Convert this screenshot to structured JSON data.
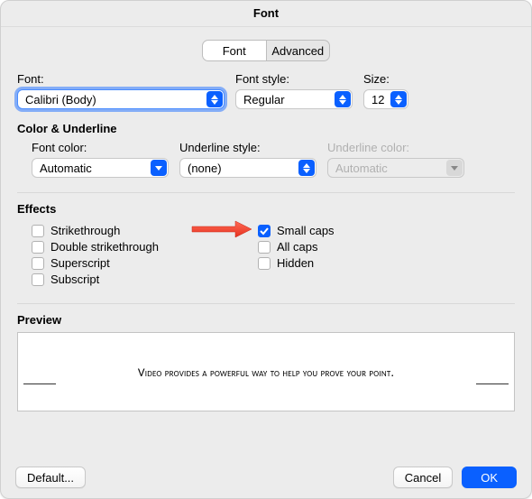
{
  "title": "Font",
  "tabs": {
    "font": "Font",
    "advanced": "Advanced"
  },
  "labels": {
    "font": "Font:",
    "font_style": "Font style:",
    "size": "Size:",
    "font_color": "Font color:",
    "underline_style": "Underline style:",
    "underline_color": "Underline color:"
  },
  "values": {
    "font": "Calibri (Body)",
    "font_style": "Regular",
    "size": "12",
    "font_color": "Automatic",
    "underline_style": "(none)",
    "underline_color": "Automatic"
  },
  "sections": {
    "color_underline": "Color & Underline",
    "effects": "Effects",
    "preview": "Preview"
  },
  "effects": {
    "strikethrough": {
      "label": "Strikethrough",
      "checked": false
    },
    "double_strikethrough": {
      "label": "Double strikethrough",
      "checked": false
    },
    "superscript": {
      "label": "Superscript",
      "checked": false
    },
    "subscript": {
      "label": "Subscript",
      "checked": false
    },
    "small_caps": {
      "label": "Small caps",
      "checked": true
    },
    "all_caps": {
      "label": "All caps",
      "checked": false
    },
    "hidden": {
      "label": "Hidden",
      "checked": false
    }
  },
  "preview_text": "Video provides a powerful way to help you prove your point.",
  "buttons": {
    "default": "Default...",
    "cancel": "Cancel",
    "ok": "OK"
  },
  "colors": {
    "accent": "#0a60ff",
    "arrow": "#f24a3d"
  }
}
